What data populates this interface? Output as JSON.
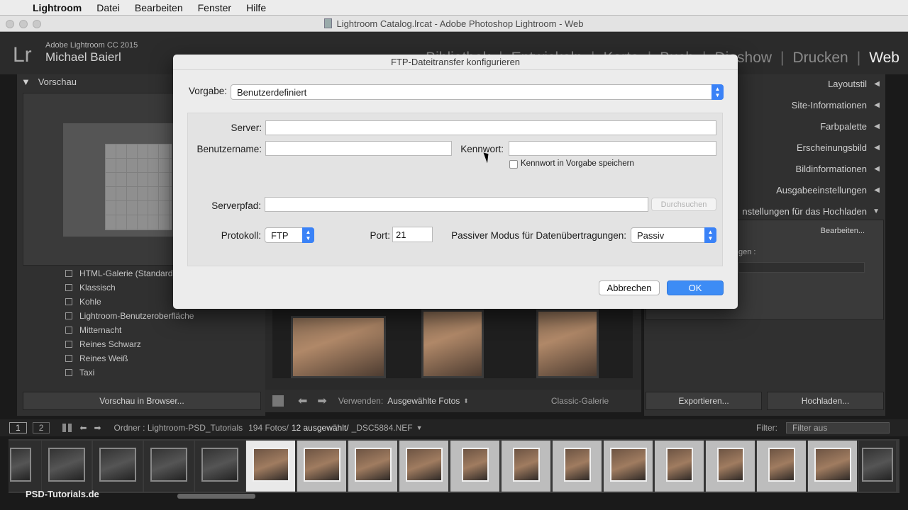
{
  "menubar": {
    "items": [
      "Lightroom",
      "Datei",
      "Bearbeiten",
      "Fenster",
      "Hilfe"
    ]
  },
  "window": {
    "title": "Lightroom Catalog.lrcat - Adobe Photoshop Lightroom - Web"
  },
  "identity": {
    "logo": "Lr",
    "product": "Adobe Lightroom CC 2015",
    "user": "Michael Baierl"
  },
  "modules": {
    "items": [
      "Bibliothek",
      "Entwickeln",
      "Karte",
      "Buch",
      "Diashow",
      "Drucken",
      "Web"
    ],
    "active": "Web"
  },
  "left_panel": {
    "header": "Vorschau",
    "templates": [
      "HTML-Galerie (Standard)",
      "Klassisch",
      "Kohle",
      "Lightroom-Benutzeroberfläche",
      "Mitternacht",
      "Reines Schwarz",
      "Reines Weiß",
      "Taxi"
    ],
    "preview_button": "Vorschau in Browser..."
  },
  "toolbar": {
    "use_label": "Verwenden:",
    "use_value": "Ausgewählte Fotos",
    "gallery_name": "Classic-Galerie"
  },
  "right_panel": {
    "sections": [
      "Layoutstil",
      "Site-Informationen",
      "Farbpalette",
      "Erscheinungsbild",
      "Bildinformationen",
      "Ausgabeeinstellungen",
      "nstellungen für das Hochladen"
    ],
    "edit_label": "Bearbeiten...",
    "partial_label": "gen :",
    "export_button": "Exportieren...",
    "upload_button": "Hochladen..."
  },
  "filmstrip": {
    "page1": "1",
    "page2": "2",
    "source": "Ordner : Lightroom-PSD_Tutorials",
    "count": "194 Fotos/",
    "selected": "12 ausgewählt/",
    "file": "_DSC5884.NEF",
    "filter_label": "Filter:",
    "filter_value": "Filter aus",
    "watermark": "PSD-Tutorials.de"
  },
  "dialog": {
    "title": "FTP-Dateitransfer konfigurieren",
    "preset_label": "Vorgabe:",
    "preset_value": "Benutzerdefiniert",
    "server_label": "Server:",
    "server_value": "",
    "username_label": "Benutzername:",
    "username_value": "",
    "password_label": "Kennwort:",
    "password_value": "",
    "save_password_label": "Kennwort in Vorgabe speichern",
    "save_password_checked": false,
    "path_label": "Serverpfad:",
    "path_value": "",
    "browse_button": "Durchsuchen",
    "protocol_label": "Protokoll:",
    "protocol_value": "FTP",
    "port_label": "Port:",
    "port_value": "21",
    "passive_label": "Passiver Modus für Datenübertragungen:",
    "passive_value": "Passiv",
    "cancel_button": "Abbrechen",
    "ok_button": "OK"
  }
}
